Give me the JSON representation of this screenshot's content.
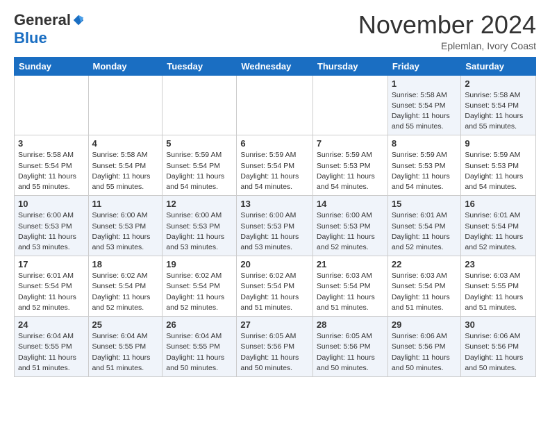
{
  "header": {
    "logo_general": "General",
    "logo_blue": "Blue",
    "title": "November 2024",
    "location": "Eplemlan, Ivory Coast"
  },
  "calendar": {
    "days_of_week": [
      "Sunday",
      "Monday",
      "Tuesday",
      "Wednesday",
      "Thursday",
      "Friday",
      "Saturday"
    ],
    "weeks": [
      [
        {
          "day": "",
          "info": ""
        },
        {
          "day": "",
          "info": ""
        },
        {
          "day": "",
          "info": ""
        },
        {
          "day": "",
          "info": ""
        },
        {
          "day": "",
          "info": ""
        },
        {
          "day": "1",
          "info": "Sunrise: 5:58 AM\nSunset: 5:54 PM\nDaylight: 11 hours and 55 minutes."
        },
        {
          "day": "2",
          "info": "Sunrise: 5:58 AM\nSunset: 5:54 PM\nDaylight: 11 hours and 55 minutes."
        }
      ],
      [
        {
          "day": "3",
          "info": "Sunrise: 5:58 AM\nSunset: 5:54 PM\nDaylight: 11 hours and 55 minutes."
        },
        {
          "day": "4",
          "info": "Sunrise: 5:58 AM\nSunset: 5:54 PM\nDaylight: 11 hours and 55 minutes."
        },
        {
          "day": "5",
          "info": "Sunrise: 5:59 AM\nSunset: 5:54 PM\nDaylight: 11 hours and 54 minutes."
        },
        {
          "day": "6",
          "info": "Sunrise: 5:59 AM\nSunset: 5:54 PM\nDaylight: 11 hours and 54 minutes."
        },
        {
          "day": "7",
          "info": "Sunrise: 5:59 AM\nSunset: 5:53 PM\nDaylight: 11 hours and 54 minutes."
        },
        {
          "day": "8",
          "info": "Sunrise: 5:59 AM\nSunset: 5:53 PM\nDaylight: 11 hours and 54 minutes."
        },
        {
          "day": "9",
          "info": "Sunrise: 5:59 AM\nSunset: 5:53 PM\nDaylight: 11 hours and 54 minutes."
        }
      ],
      [
        {
          "day": "10",
          "info": "Sunrise: 6:00 AM\nSunset: 5:53 PM\nDaylight: 11 hours and 53 minutes."
        },
        {
          "day": "11",
          "info": "Sunrise: 6:00 AM\nSunset: 5:53 PM\nDaylight: 11 hours and 53 minutes."
        },
        {
          "day": "12",
          "info": "Sunrise: 6:00 AM\nSunset: 5:53 PM\nDaylight: 11 hours and 53 minutes."
        },
        {
          "day": "13",
          "info": "Sunrise: 6:00 AM\nSunset: 5:53 PM\nDaylight: 11 hours and 53 minutes."
        },
        {
          "day": "14",
          "info": "Sunrise: 6:00 AM\nSunset: 5:53 PM\nDaylight: 11 hours and 52 minutes."
        },
        {
          "day": "15",
          "info": "Sunrise: 6:01 AM\nSunset: 5:54 PM\nDaylight: 11 hours and 52 minutes."
        },
        {
          "day": "16",
          "info": "Sunrise: 6:01 AM\nSunset: 5:54 PM\nDaylight: 11 hours and 52 minutes."
        }
      ],
      [
        {
          "day": "17",
          "info": "Sunrise: 6:01 AM\nSunset: 5:54 PM\nDaylight: 11 hours and 52 minutes."
        },
        {
          "day": "18",
          "info": "Sunrise: 6:02 AM\nSunset: 5:54 PM\nDaylight: 11 hours and 52 minutes."
        },
        {
          "day": "19",
          "info": "Sunrise: 6:02 AM\nSunset: 5:54 PM\nDaylight: 11 hours and 52 minutes."
        },
        {
          "day": "20",
          "info": "Sunrise: 6:02 AM\nSunset: 5:54 PM\nDaylight: 11 hours and 51 minutes."
        },
        {
          "day": "21",
          "info": "Sunrise: 6:03 AM\nSunset: 5:54 PM\nDaylight: 11 hours and 51 minutes."
        },
        {
          "day": "22",
          "info": "Sunrise: 6:03 AM\nSunset: 5:54 PM\nDaylight: 11 hours and 51 minutes."
        },
        {
          "day": "23",
          "info": "Sunrise: 6:03 AM\nSunset: 5:55 PM\nDaylight: 11 hours and 51 minutes."
        }
      ],
      [
        {
          "day": "24",
          "info": "Sunrise: 6:04 AM\nSunset: 5:55 PM\nDaylight: 11 hours and 51 minutes."
        },
        {
          "day": "25",
          "info": "Sunrise: 6:04 AM\nSunset: 5:55 PM\nDaylight: 11 hours and 51 minutes."
        },
        {
          "day": "26",
          "info": "Sunrise: 6:04 AM\nSunset: 5:55 PM\nDaylight: 11 hours and 50 minutes."
        },
        {
          "day": "27",
          "info": "Sunrise: 6:05 AM\nSunset: 5:56 PM\nDaylight: 11 hours and 50 minutes."
        },
        {
          "day": "28",
          "info": "Sunrise: 6:05 AM\nSunset: 5:56 PM\nDaylight: 11 hours and 50 minutes."
        },
        {
          "day": "29",
          "info": "Sunrise: 6:06 AM\nSunset: 5:56 PM\nDaylight: 11 hours and 50 minutes."
        },
        {
          "day": "30",
          "info": "Sunrise: 6:06 AM\nSunset: 5:56 PM\nDaylight: 11 hours and 50 minutes."
        }
      ]
    ]
  }
}
